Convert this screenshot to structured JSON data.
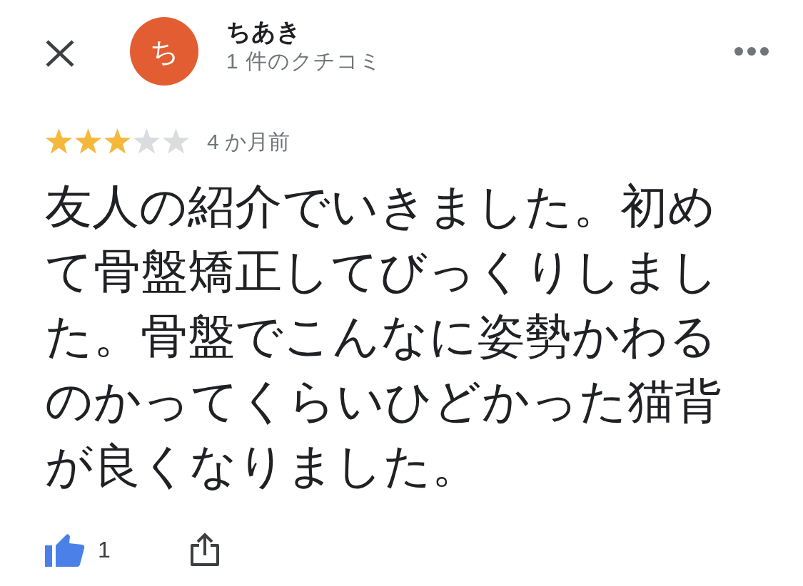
{
  "reviewer": {
    "avatar_letter": "ち",
    "name": "ちあき",
    "review_count": "1 件のクチコミ"
  },
  "review": {
    "stars": 3,
    "time": "4 か月前",
    "text": "友人の紹介でいきました。初めて骨盤矯正してびっくりしました。骨盤でこんなに姿勢かわるのかってくらいひどかった猫背が良くなりました。"
  },
  "actions": {
    "like_count": "1"
  }
}
